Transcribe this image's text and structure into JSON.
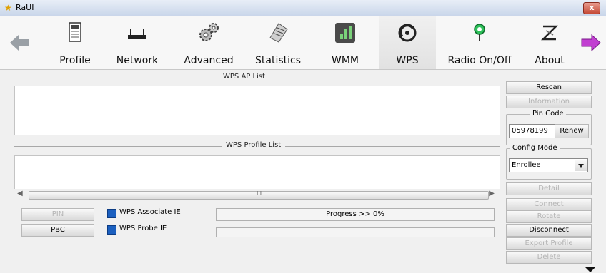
{
  "window": {
    "title": "RaUI",
    "close": "x"
  },
  "toolbar": {
    "items": [
      {
        "id": "profile",
        "label": "Profile"
      },
      {
        "id": "network",
        "label": "Network"
      },
      {
        "id": "advanced",
        "label": "Advanced"
      },
      {
        "id": "statistics",
        "label": "Statistics"
      },
      {
        "id": "wmm",
        "label": "WMM"
      },
      {
        "id": "wps",
        "label": "WPS"
      },
      {
        "id": "radio",
        "label": "Radio On/Off"
      },
      {
        "id": "about",
        "label": "About"
      }
    ],
    "active": "wps"
  },
  "wps": {
    "ap_list_title": "WPS AP List",
    "profile_list_title": "WPS Profile List",
    "pin_code_title": "Pin Code",
    "pin_code_value": "05978199",
    "config_mode_title": "Config Mode",
    "config_mode_value": "Enrollee",
    "scroll_thumb": "III",
    "buttons": {
      "rescan": "Rescan",
      "information": "Information",
      "renew": "Renew",
      "detail": "Detail",
      "connect": "Connect",
      "rotate": "Rotate",
      "disconnect": "Disconnect",
      "export_profile": "Export Profile",
      "delete": "Delete",
      "pin": "PIN",
      "pbc": "PBC"
    },
    "checkboxes": {
      "associate_ie": "WPS Associate IE",
      "probe_ie": "WPS Probe IE"
    },
    "progress": "Progress >> 0%"
  }
}
